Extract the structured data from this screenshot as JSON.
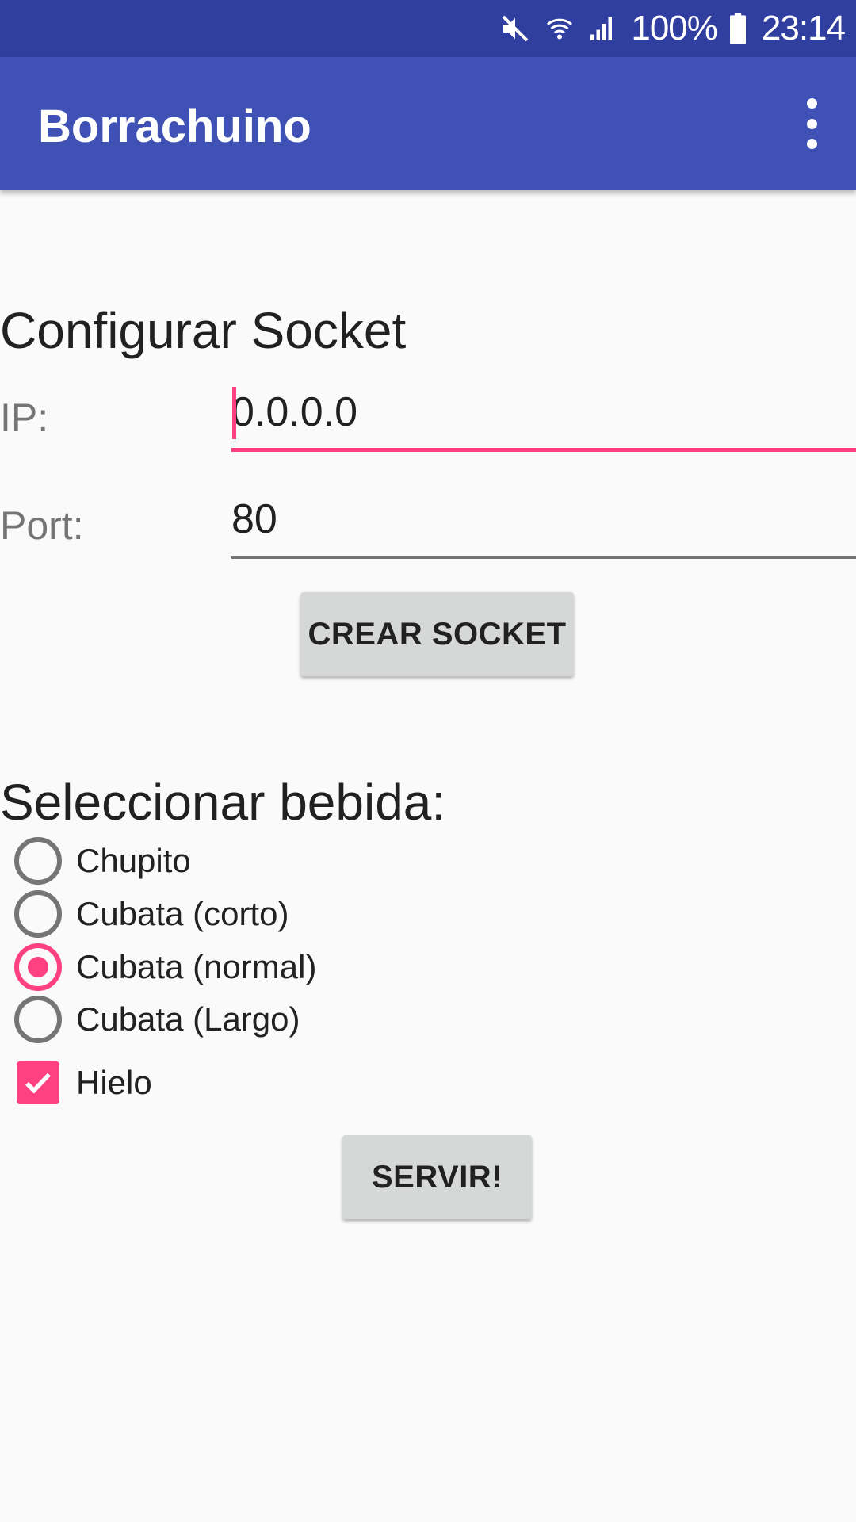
{
  "status_bar": {
    "icons": [
      "mute-icon",
      "wifi-icon",
      "signal-icon",
      "battery-icon"
    ],
    "battery": "100%",
    "time": "23:14",
    "color": "#303f9f"
  },
  "app_bar": {
    "title": "Borrachuino",
    "menu_icon": "more-vert-icon",
    "color": "#3f51b5"
  },
  "socket": {
    "title": "Configurar Socket",
    "ip_label": "IP:",
    "ip_value": "0.0.0.0",
    "port_label": "Port:",
    "port_value": "80",
    "create_button": "CREAR SOCKET"
  },
  "drinks": {
    "title": "Seleccionar bebida:",
    "options": [
      {
        "label": "Chupito",
        "checked": false
      },
      {
        "label": "Cubata (corto)",
        "checked": false
      },
      {
        "label": "Cubata (normal)",
        "checked": true
      },
      {
        "label": "Cubata (Largo)",
        "checked": false
      }
    ],
    "ice_label": "Hielo",
    "ice_checked": true,
    "serve_button": "SERVIR!"
  },
  "accent_color": "#ff4081"
}
